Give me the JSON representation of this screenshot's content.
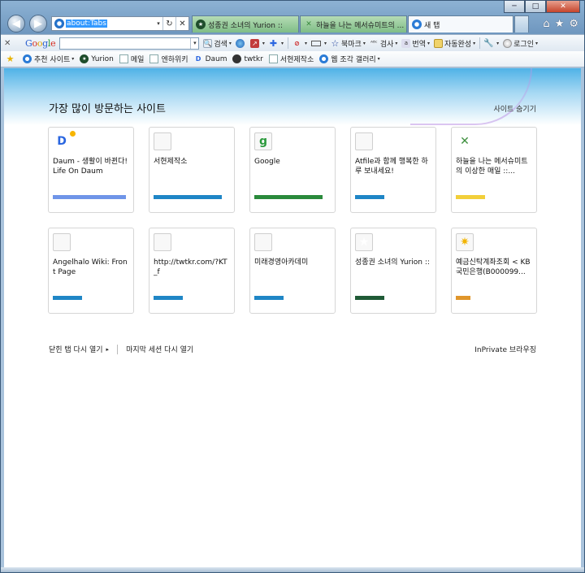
{
  "window": {
    "caption": {
      "minimize": "─",
      "maximize": "□",
      "close": "✕"
    }
  },
  "nav": {
    "back": "◀",
    "forward": "▶",
    "address": {
      "value": "about:Tabs",
      "refresh": "↻",
      "stop": "✕",
      "dropdown": "▾"
    }
  },
  "tabs": [
    {
      "label": "성종권 소녀의 Yurion ::",
      "icon": "starbucks-icon"
    },
    {
      "label": "하늘을 나는 메서슈미트의 ...",
      "icon": "x-logo-icon"
    },
    {
      "label": "새 탭",
      "icon": "ie-icon",
      "active": true
    }
  ],
  "right_icons": {
    "home": "⌂",
    "favorites": "★",
    "tools": "⚙"
  },
  "toolbar": {
    "close": "✕",
    "google_logo": [
      "G",
      "o",
      "o",
      "g",
      "l",
      "e"
    ],
    "search_dropdown": "▾",
    "items": [
      {
        "label": "검색",
        "icon": "search-icon",
        "caret": true
      },
      {
        "label": "",
        "icon": "earth-icon",
        "caret": false
      },
      {
        "label": "",
        "icon": "share-icon",
        "caret": true
      },
      {
        "label": "",
        "icon": "plus-icon",
        "caret": true
      },
      {
        "label": "",
        "icon": "blocked-icon",
        "caret": true
      },
      {
        "label": "",
        "icon": "rect-icon",
        "caret": true
      },
      {
        "label": "북마크",
        "icon": "bookmark-star-icon",
        "caret": true
      },
      {
        "label": "검사",
        "icon": "spellcheck-icon",
        "caret": true
      },
      {
        "label": "번역",
        "icon": "translate-icon",
        "caret": true
      },
      {
        "label": "자동완성",
        "icon": "autofill-icon",
        "caret": true
      },
      {
        "label": "",
        "icon": "wrench-icon",
        "caret": true
      },
      {
        "label": "로그인",
        "icon": "login-icon",
        "caret": true
      }
    ]
  },
  "favorites": {
    "items": [
      {
        "label": "추천 사이트",
        "icon": "ie-icon",
        "caret": "▾"
      },
      {
        "label": "Yurion",
        "icon": "starbucks-icon",
        "caret": ""
      },
      {
        "label": "메일",
        "icon": "page-icon",
        "caret": ""
      },
      {
        "label": "엔하위키",
        "icon": "page-icon",
        "caret": ""
      },
      {
        "label": "Daum",
        "icon": "daum-icon",
        "caret": ""
      },
      {
        "label": "twtkr",
        "icon": "bird-icon",
        "caret": ""
      },
      {
        "label": "서현제작소",
        "icon": "page-icon",
        "caret": ""
      },
      {
        "label": "웹 조각 갤러리",
        "icon": "ie-icon",
        "caret": "▾"
      }
    ]
  },
  "page": {
    "title": "가장 많이 방문하는 사이트",
    "hide_sites": "사이트 숨기기",
    "tiles": [
      {
        "label": "Daum - 생활이 바뀐다! Life On Daum",
        "icon": "daum-icon",
        "glyph": "D",
        "bar_color": "#6f95e8",
        "bar_fraction": 0.94
      },
      {
        "label": "서현제작소",
        "icon": "blank-page-icon",
        "glyph": "",
        "bar_color": "#1f86c6",
        "bar_fraction": 0.88
      },
      {
        "label": "Google",
        "icon": "google-icon",
        "glyph": "g",
        "bar_color": "#2a8a3c",
        "bar_fraction": 0.88
      },
      {
        "label": "Atfile과 함께 행복한 하루 보내세요!",
        "icon": "blank-page-icon",
        "glyph": "",
        "bar_color": "#1f86c6",
        "bar_fraction": 0.38
      },
      {
        "label": "하늘을 나는 메서슈미트의 이상한 매일 ::...",
        "icon": "x-logo-icon",
        "glyph": "✕",
        "bar_color": "#f2cf3a",
        "bar_fraction": 0.38
      },
      {
        "label": "Angelhalo Wiki: Front Page",
        "icon": "blank-page-icon",
        "glyph": "",
        "bar_color": "#1f86c6",
        "bar_fraction": 0.38
      },
      {
        "label": "http://twtkr.com/?KT_f",
        "icon": "blank-page-icon",
        "glyph": "",
        "bar_color": "#1f86c6",
        "bar_fraction": 0.38
      },
      {
        "label": "미래경영아카데미",
        "icon": "blank-page-icon",
        "glyph": "",
        "bar_color": "#1f86c6",
        "bar_fraction": 0.38
      },
      {
        "label": "성종권 소녀의 Yurion ::",
        "icon": "starbucks-icon",
        "glyph": "★",
        "bar_color": "#1f5a36",
        "bar_fraction": 0.38
      },
      {
        "label": "예금신탁계좌조회 < KB국민은행(B000099...",
        "icon": "kb-bank-icon",
        "glyph": "✷",
        "bar_color": "#e0962b",
        "bar_fraction": 0.19
      }
    ],
    "reopen_closed_tabs": "닫힌 탭 다시 열기",
    "reopen_caret": "▸",
    "reopen_last_session": "마지막 세션 다시 열기",
    "inprivate": "InPrivate 브라우징"
  }
}
